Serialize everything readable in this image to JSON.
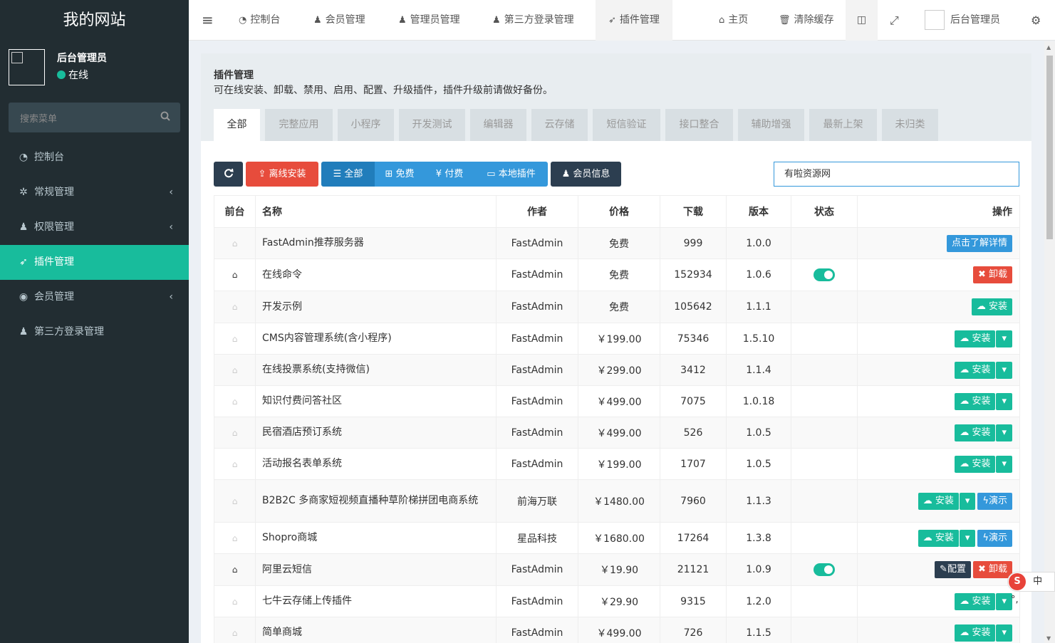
{
  "sidebar": {
    "logo": "我的网站",
    "user": {
      "name": "后台管理员",
      "status": "在线"
    },
    "search_placeholder": "搜索菜单",
    "items": [
      {
        "label": "控制台",
        "icon": "dashboard-icon",
        "glyph": "◔",
        "has_arrow": false,
        "active": false
      },
      {
        "label": "常规管理",
        "icon": "cogs-icon",
        "glyph": "✲",
        "has_arrow": true,
        "active": false
      },
      {
        "label": "权限管理",
        "icon": "users-icon",
        "glyph": "♟",
        "has_arrow": true,
        "active": false
      },
      {
        "label": "插件管理",
        "icon": "rocket-icon",
        "glyph": "➶",
        "has_arrow": false,
        "active": true
      },
      {
        "label": "会员管理",
        "icon": "user-circle-icon",
        "glyph": "◉",
        "has_arrow": true,
        "active": false
      },
      {
        "label": "第三方登录管理",
        "icon": "users-icon",
        "glyph": "♟",
        "has_arrow": false,
        "active": false
      }
    ]
  },
  "topnav": {
    "menu_toggle": "≡",
    "tabs": [
      {
        "label": "控制台",
        "glyph": "◔"
      },
      {
        "label": "会员管理",
        "glyph": "♟"
      },
      {
        "label": "管理员管理",
        "glyph": "♟"
      },
      {
        "label": "第三方登录管理",
        "glyph": "♟"
      },
      {
        "label": "插件管理",
        "glyph": "➶"
      }
    ],
    "home": "主页",
    "clear_cache": "清除缓存",
    "admin": "后台管理员"
  },
  "page": {
    "title": "插件管理",
    "description": "可在线安装、卸载、禁用、启用、配置、升级插件，插件升级前请做好备份。",
    "tabs": [
      "全部",
      "完整应用",
      "小程序",
      "开发测试",
      "编辑器",
      "云存储",
      "短信验证",
      "接口整合",
      "辅助增强",
      "最新上架",
      "未归类"
    ],
    "active_tab": 0
  },
  "toolbar": {
    "offline_install": "离线安装",
    "filter_all": "全部",
    "filter_free": "免费",
    "filter_paid": "付费",
    "filter_local": "本地插件",
    "member_info": "会员信息",
    "search_value": "有啦资源网"
  },
  "table": {
    "headers": [
      "前台",
      "名称",
      "作者",
      "价格",
      "下载",
      "版本",
      "状态",
      "操作"
    ],
    "rows": [
      {
        "home": false,
        "name": "FastAdmin推荐服务器",
        "author": "FastAdmin",
        "price": "免费",
        "paid": false,
        "downloads": "999",
        "version": "1.0.0",
        "status": false,
        "actions": [
          "details"
        ]
      },
      {
        "home": true,
        "name": "在线命令",
        "author": "FastAdmin",
        "price": "免费",
        "paid": false,
        "downloads": "152934",
        "version": "1.0.6",
        "status": true,
        "actions": [
          "uninstall"
        ]
      },
      {
        "home": false,
        "name": "开发示例",
        "author": "FastAdmin",
        "price": "免费",
        "paid": false,
        "downloads": "105642",
        "version": "1.1.1",
        "status": false,
        "actions": [
          "install"
        ]
      },
      {
        "home": false,
        "name": "CMS内容管理系统(含小程序)",
        "author": "FastAdmin",
        "price": "￥199.00",
        "paid": true,
        "downloads": "75346",
        "version": "1.5.10",
        "status": false,
        "actions": [
          "install-drop"
        ]
      },
      {
        "home": false,
        "name": "在线投票系统(支持微信)",
        "author": "FastAdmin",
        "price": "￥299.00",
        "paid": true,
        "downloads": "3412",
        "version": "1.1.4",
        "status": false,
        "actions": [
          "install-drop"
        ]
      },
      {
        "home": false,
        "name": "知识付费问答社区",
        "author": "FastAdmin",
        "price": "￥499.00",
        "paid": true,
        "downloads": "7075",
        "version": "1.0.18",
        "status": false,
        "actions": [
          "install-drop"
        ]
      },
      {
        "home": false,
        "name": "民宿酒店预订系统",
        "author": "FastAdmin",
        "price": "￥499.00",
        "paid": true,
        "downloads": "526",
        "version": "1.0.5",
        "status": false,
        "actions": [
          "install-drop"
        ]
      },
      {
        "home": false,
        "name": "活动报名表单系统",
        "author": "FastAdmin",
        "price": "￥199.00",
        "paid": true,
        "downloads": "1707",
        "version": "1.0.5",
        "status": false,
        "actions": [
          "install-drop"
        ]
      },
      {
        "home": false,
        "name": "B2B2C 多商家短视频直播种草阶梯拼团电商系统",
        "author": "前海万联",
        "price": "￥1480.00",
        "paid": true,
        "downloads": "7960",
        "version": "1.1.3",
        "status": false,
        "actions": [
          "install-drop",
          "demo"
        ]
      },
      {
        "home": false,
        "name": "Shopro商城",
        "author": "星品科技",
        "price": "￥1680.00",
        "paid": true,
        "downloads": "17264",
        "version": "1.3.8",
        "status": false,
        "actions": [
          "install-drop",
          "demo"
        ]
      },
      {
        "home": true,
        "name": "阿里云短信",
        "author": "FastAdmin",
        "price": "￥19.90",
        "paid": true,
        "downloads": "21121",
        "version": "1.0.9",
        "status": true,
        "actions": [
          "config",
          "uninstall"
        ]
      },
      {
        "home": false,
        "name": "七牛云存储上传插件",
        "author": "FastAdmin",
        "price": "￥29.90",
        "paid": true,
        "downloads": "9315",
        "version": "1.2.0",
        "status": false,
        "actions": [
          "install-drop"
        ]
      },
      {
        "home": false,
        "name": "简单商城",
        "author": "FastAdmin",
        "price": "￥499.00",
        "paid": true,
        "downloads": "726",
        "version": "1.1.5",
        "status": false,
        "actions": [
          "install-drop"
        ]
      }
    ],
    "labels": {
      "details": "点击了解详情",
      "install": "安装",
      "uninstall": "卸载",
      "config": "配置",
      "demo": "演示"
    }
  },
  "ime": {
    "logo": "S",
    "mode": "中"
  },
  "colors": {
    "sidebar_bg": "#222d32",
    "accent": "#18bc9c",
    "danger": "#e74c3c",
    "primary": "#3498db",
    "dark": "#2c3e50"
  }
}
